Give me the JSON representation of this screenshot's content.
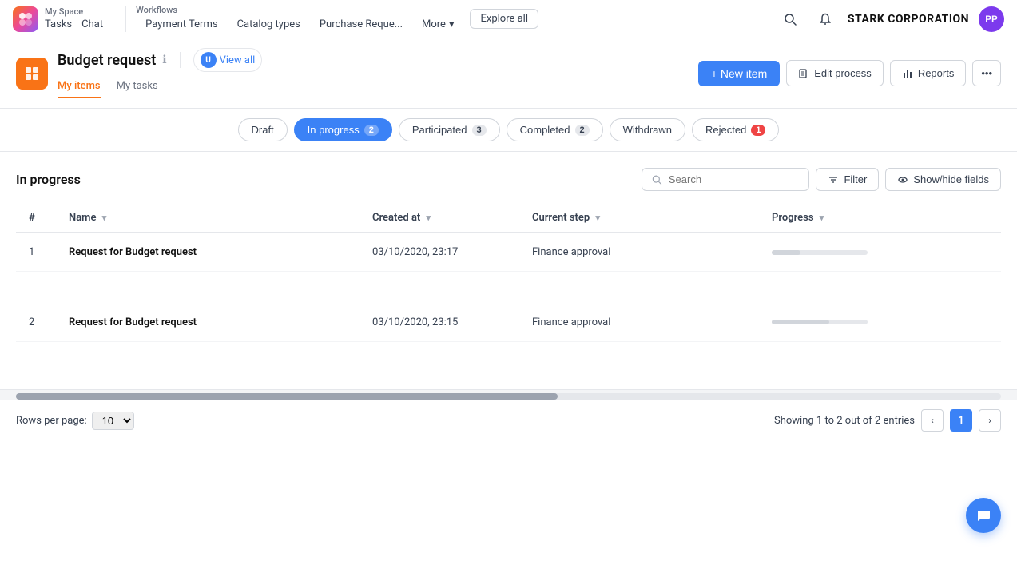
{
  "app": {
    "company": "STARK CORPORATION",
    "user_initials": "PP"
  },
  "nav": {
    "my_space_label": "My Space",
    "tasks_label": "Tasks",
    "chat_label": "Chat",
    "workflows_label": "Workflows",
    "payment_terms_label": "Payment Terms",
    "catalog_types_label": "Catalog types",
    "purchase_request_label": "Purchase Reque...",
    "more_label": "More",
    "explore_all_label": "Explore all"
  },
  "page": {
    "title": "Budget request",
    "view_all_label": "View all",
    "my_items_label": "My items",
    "my_tasks_label": "My tasks"
  },
  "actions": {
    "new_item_label": "+ New item",
    "edit_process_label": "Edit process",
    "reports_label": "Reports"
  },
  "tabs": [
    {
      "id": "draft",
      "label": "Draft",
      "badge": null,
      "active": false
    },
    {
      "id": "in_progress",
      "label": "In progress",
      "badge": "2",
      "active": true
    },
    {
      "id": "participated",
      "label": "Participated",
      "badge": "3",
      "active": false
    },
    {
      "id": "completed",
      "label": "Completed",
      "badge": "2",
      "active": false
    },
    {
      "id": "withdrawn",
      "label": "Withdrawn",
      "badge": null,
      "active": false
    },
    {
      "id": "rejected",
      "label": "Rejected",
      "badge": "1",
      "badge_red": true,
      "active": false
    }
  ],
  "table": {
    "section_title": "In progress",
    "search_placeholder": "Search",
    "filter_label": "Filter",
    "show_hide_label": "Show/hide fields",
    "columns": [
      {
        "id": "hash",
        "label": "#"
      },
      {
        "id": "name",
        "label": "Name"
      },
      {
        "id": "created_at",
        "label": "Created at"
      },
      {
        "id": "current_step",
        "label": "Current step"
      },
      {
        "id": "progress",
        "label": "Progress"
      }
    ],
    "rows": [
      {
        "number": "1",
        "name": "Request for Budget request",
        "created_at": "03/10/2020, 23:17",
        "current_step": "Finance approval",
        "progress_pct": 30
      },
      {
        "number": "2",
        "name": "Request for Budget request",
        "created_at": "03/10/2020, 23:15",
        "current_step": "Finance approval",
        "progress_pct": 60
      }
    ]
  },
  "footer": {
    "rows_per_page_label": "Rows per page:",
    "rows_per_page_value": "10",
    "showing_text": "Showing 1 to 2 out of 2 entries",
    "current_page": "1"
  }
}
